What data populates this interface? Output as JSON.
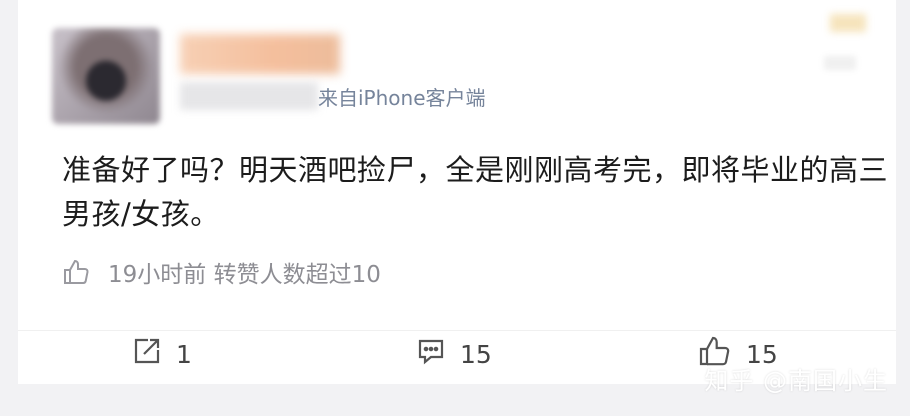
{
  "post": {
    "source": "来自iPhone客户端",
    "text": "准备好了吗？明天酒吧捡尸，全是刚刚高考完，即将毕业的高三男孩/女孩。",
    "meta": "19小时前 转赞人数超过10"
  },
  "actions": {
    "share_count": "1",
    "comment_count": "15",
    "like_count": "15"
  },
  "watermark": "知乎 @南国小生",
  "colors": {
    "source": "#76849b",
    "text": "#1c1c1c",
    "meta": "#8d8d93",
    "background": "#f2f2f4"
  }
}
